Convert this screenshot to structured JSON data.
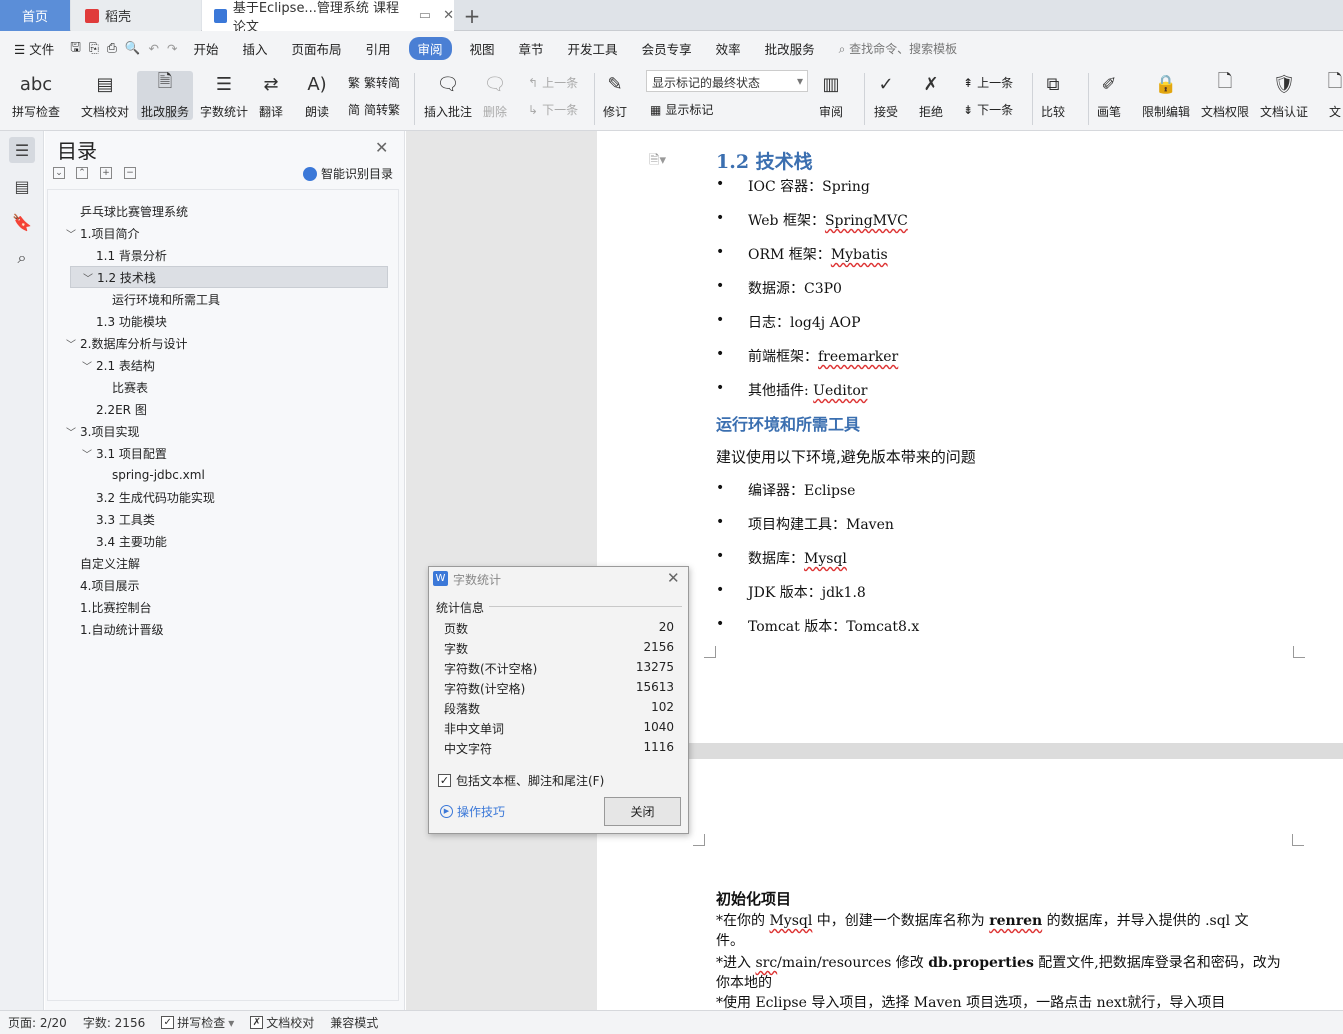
{
  "tabs": {
    "home": "首页",
    "daoke": "稻壳",
    "doc": "基于Eclipse...管理系统 课程论文"
  },
  "menu": [
    "文件",
    "开始",
    "插入",
    "页面布局",
    "引用",
    "审阅",
    "视图",
    "章节",
    "开发工具",
    "会员专享",
    "效率",
    "批改服务"
  ],
  "menu_active": "审阅",
  "search_placeholder": "查找命令、搜索模板",
  "ribbon": {
    "spellcheck": "拼写检查",
    "doccheck": "文档校对",
    "correction": "批改服务",
    "wordcount": "字数统计",
    "translate": "翻译",
    "read": "朗读",
    "trad": "繁转简",
    "simp": "简转繁",
    "insert_comment": "插入批注",
    "delete": "删除",
    "prev": "上一条",
    "next": "下一条",
    "revise": "修订",
    "markup_state": "显示标记的最终状态",
    "show_markup": "显示标记",
    "review": "审阅",
    "accept": "接受",
    "reject": "拒绝",
    "prev2": "上一条",
    "next2": "下一条",
    "compare": "比较",
    "pen": "画笔",
    "restrict": "限制编辑",
    "perm": "文档权限",
    "cert": "文档认证",
    "more": "文"
  },
  "nav": {
    "title": "目录",
    "smart": "智能识别目录",
    "items": [
      {
        "text": "乒乓球比赛管理系统",
        "level": 0,
        "caret": ""
      },
      {
        "text": "1.项目简介",
        "level": 0,
        "caret": "v"
      },
      {
        "text": "1.1 背景分析",
        "level": 1,
        "caret": ""
      },
      {
        "text": "1.2 技术栈",
        "level": 1,
        "caret": "v",
        "selected": true
      },
      {
        "text": "运行环境和所需工具",
        "level": 2,
        "caret": ""
      },
      {
        "text": "1.3 功能模块",
        "level": 1,
        "caret": ""
      },
      {
        "text": "2.数据库分析与设计",
        "level": 0,
        "caret": "v"
      },
      {
        "text": "2.1 表结构",
        "level": 1,
        "caret": "v"
      },
      {
        "text": "比赛表",
        "level": 2,
        "caret": ""
      },
      {
        "text": "2.2ER 图",
        "level": 1,
        "caret": ""
      },
      {
        "text": "3.项目实现",
        "level": 0,
        "caret": "v"
      },
      {
        "text": "3.1 项目配置",
        "level": 1,
        "caret": "v"
      },
      {
        "text": "spring-jdbc.xml",
        "level": 2,
        "caret": ""
      },
      {
        "text": "3.2 生成代码功能实现",
        "level": 1,
        "caret": ""
      },
      {
        "text": "3.3 工具类",
        "level": 1,
        "caret": ""
      },
      {
        "text": "3.4 主要功能",
        "level": 1,
        "caret": ""
      },
      {
        "text": "自定义注解",
        "level": 0,
        "caret": ""
      },
      {
        "text": "4.项目展示",
        "level": 0,
        "caret": ""
      },
      {
        "text": "1.比赛控制台",
        "level": 0,
        "caret": ""
      },
      {
        "text": "1.自动统计晋级",
        "level": 0,
        "caret": ""
      }
    ]
  },
  "doc": {
    "h12": "1.2 技术栈",
    "stack": [
      {
        "label": "IOC 容器：",
        "value": "Spring",
        "wavy": false
      },
      {
        "label": "Web 框架：",
        "value": "SpringMVC",
        "wavy": true
      },
      {
        "label": "ORM 框架：",
        "value": "Mybatis",
        "wavy": true
      },
      {
        "label": "数据源：",
        "value": "C3P0",
        "wavy": false
      },
      {
        "label": "日志：",
        "value": "log4j AOP",
        "wavy": false
      },
      {
        "label": "前端框架：",
        "value": "freemarker",
        "wavy": true
      },
      {
        "label": "其他插件: ",
        "value": "Ueditor",
        "wavy": true
      }
    ],
    "h_env": "运行环境和所需工具",
    "env_intro": "建议使用以下环境,避免版本带来的问题",
    "env": [
      {
        "label": "编译器：",
        "value": "Eclipse",
        "wavy": false
      },
      {
        "label": "项目构建工具：",
        "value": "Maven",
        "wavy": false
      },
      {
        "label": "数据库：",
        "value": "Mysql",
        "wavy": true
      },
      {
        "label": "JDK 版本：",
        "value": "jdk1.8",
        "wavy": false
      },
      {
        "label": "Tomcat 版本：",
        "value": "Tomcat8.x",
        "wavy": false
      }
    ],
    "init_title": "初始化项目",
    "p1a": "*在你的 ",
    "p1b": "Mysql",
    "p1c": " 中，创建一个数据库名称为 ",
    "p1d": "renren",
    "p1e": " 的数据库，并导入提供的 .sql 文",
    "p1f": "件。",
    "p2a": "*进入 ",
    "p2b": "src",
    "p2c": "/main/resources 修改 ",
    "p2d": "db.properties",
    "p2e": " 配置文件,把数据库登录名和密码，改为",
    "p2f": "你本地的",
    "p3": "*使用 Eclipse 导入项目，选择 Maven 项目选项，一路点击 next就行，导入项目"
  },
  "dialog": {
    "title": "字数统计",
    "section": "统计信息",
    "rows": [
      {
        "k": "页数",
        "v": "20"
      },
      {
        "k": "字数",
        "v": "2156"
      },
      {
        "k": "字符数(不计空格)",
        "v": "13275"
      },
      {
        "k": "字符数(计空格)",
        "v": "15613"
      },
      {
        "k": "段落数",
        "v": "102"
      },
      {
        "k": "非中文单词",
        "v": "1040"
      },
      {
        "k": "中文字符",
        "v": "1116"
      }
    ],
    "checkbox": "包括文本框、脚注和尾注(F)",
    "tips": "操作技巧",
    "close": "关闭"
  },
  "status": {
    "page": "页面: 2/20",
    "words": "字数: 2156",
    "spell": "拼写检查",
    "doccheck": "文档校对",
    "compat": "兼容模式"
  }
}
